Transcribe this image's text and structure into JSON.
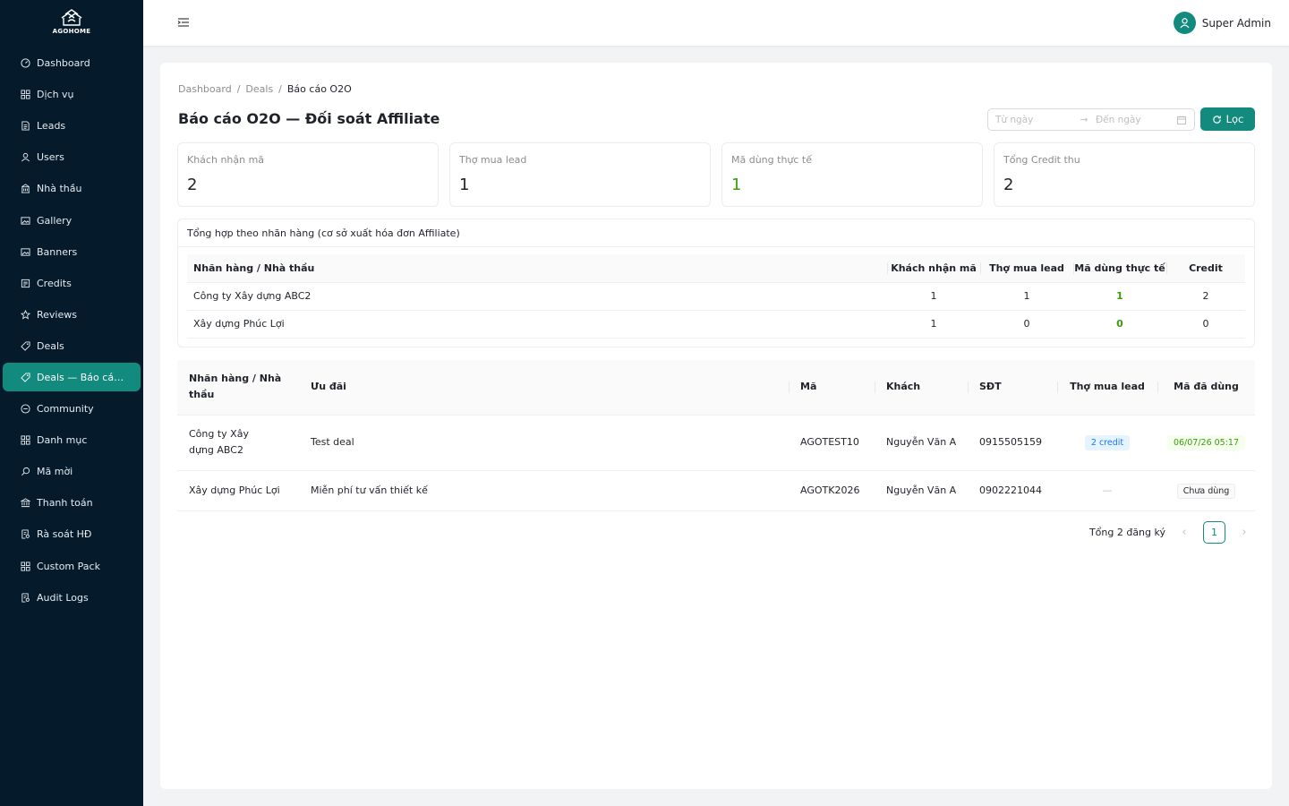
{
  "brand": {
    "name": "AGOHOME",
    "accent": "#138a7e",
    "sidebar_bg": "#051b2c"
  },
  "sidebar": {
    "items": [
      {
        "label": "Dashboard",
        "icon": "dashboard-icon"
      },
      {
        "label": "Dịch vụ",
        "icon": "grid-icon"
      },
      {
        "label": "Leads",
        "icon": "file-icon"
      },
      {
        "label": "Users",
        "icon": "user-icon"
      },
      {
        "label": "Nhà thầu",
        "icon": "building-icon"
      },
      {
        "label": "Gallery",
        "icon": "picture-icon"
      },
      {
        "label": "Banners",
        "icon": "picture-icon"
      },
      {
        "label": "Credits",
        "icon": "credit-icon"
      },
      {
        "label": "Reviews",
        "icon": "star-icon"
      },
      {
        "label": "Deals",
        "icon": "tag-icon"
      },
      {
        "label": "Deals — Báo cáo ...",
        "icon": "tag-icon",
        "active": true
      },
      {
        "label": "Community",
        "icon": "message-icon"
      },
      {
        "label": "Danh mục",
        "icon": "grid-icon"
      },
      {
        "label": "Mã mời",
        "icon": "search-icon"
      },
      {
        "label": "Thanh toán",
        "icon": "bank-icon"
      },
      {
        "label": "Rà soát HĐ",
        "icon": "audit-icon"
      },
      {
        "label": "Custom Pack",
        "icon": "grid-icon"
      },
      {
        "label": "Audit Logs",
        "icon": "audit-icon"
      }
    ]
  },
  "header": {
    "user_name": "Super Admin"
  },
  "breadcrumb": [
    "Dashboard",
    "Deals",
    "Báo cáo O2O"
  ],
  "page": {
    "title": "Báo cáo O2O — Đối soát Affiliate",
    "date_from_placeholder": "Từ ngày",
    "date_to_placeholder": "Đến ngày",
    "filter_label": "Lọc"
  },
  "stats": [
    {
      "label": "Khách nhận mã",
      "value": "2"
    },
    {
      "label": "Thợ mua lead",
      "value": "1"
    },
    {
      "label": "Mã dùng thực tế",
      "value": "1"
    },
    {
      "label": "Tổng Credit thu",
      "value": "2"
    }
  ],
  "summary": {
    "title": "Tổng hợp theo nhãn hàng (cơ sở xuất hóa đơn Affiliate)",
    "columns": [
      "Nhãn hàng / Nhà thầu",
      "Khách nhận mã",
      "Thợ mua lead",
      "Mã dùng thực tế",
      "Credit"
    ],
    "rows": [
      [
        "Công ty Xây dựng ABC2",
        "1",
        "1",
        "1",
        "2"
      ],
      [
        "Xây dựng Phúc Lợi",
        "1",
        "0",
        "0",
        "0"
      ]
    ]
  },
  "details": {
    "columns": [
      "Nhãn hàng / Nhà thầu",
      "Ưu đãi",
      "Mã",
      "Khách",
      "SĐT",
      "Thợ mua lead",
      "Mã đã dùng"
    ],
    "rows": [
      {
        "brand": "Công ty Xây dựng ABC2",
        "deal": "Test deal",
        "code": "AGOTEST10",
        "customer": "Nguyễn Văn A",
        "phone": "0915505159",
        "lead": "2 credit",
        "used": "06/07/26 05:17"
      },
      {
        "brand": "Xây dựng Phúc Lợi",
        "deal": "Miễn phí tư vấn thiết kế",
        "code": "AGOTK2026",
        "customer": "Nguyễn Văn A",
        "phone": "0902221044",
        "lead": "—",
        "used": "Chưa dùng"
      }
    ]
  },
  "pagination": {
    "total_label": "Tổng 2 đăng ký",
    "current_page": "1"
  }
}
